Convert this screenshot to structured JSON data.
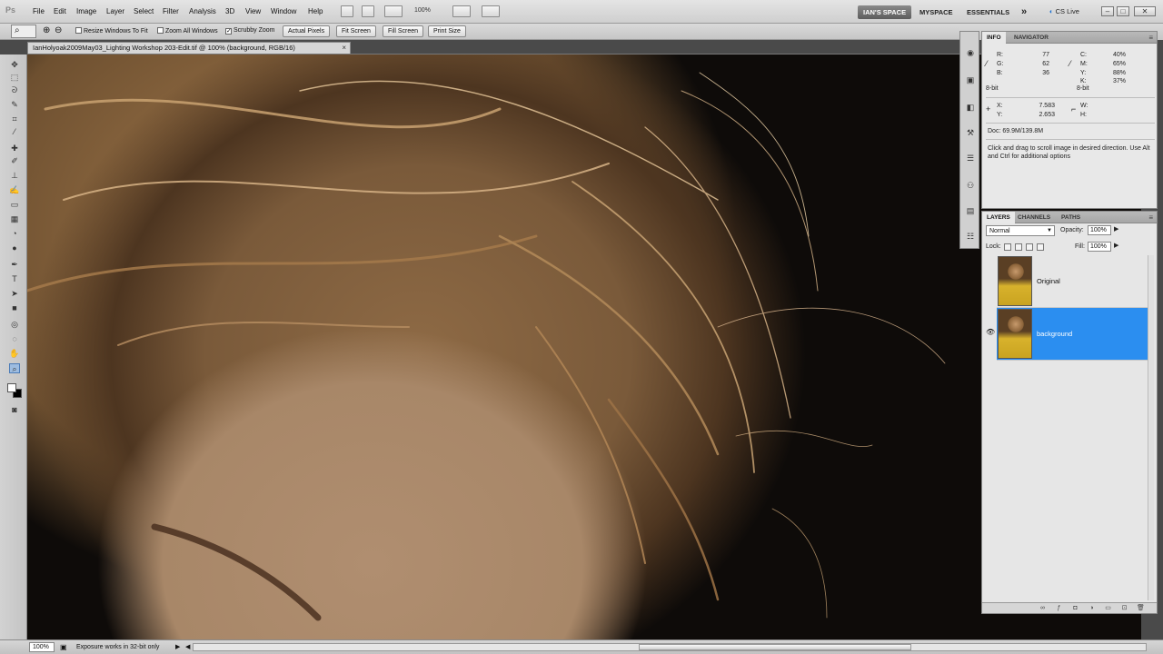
{
  "app": {
    "logo": "Ps"
  },
  "menu": [
    "File",
    "Edit",
    "Image",
    "Layer",
    "Select",
    "Filter",
    "Analysis",
    "3D",
    "View",
    "Window",
    "Help"
  ],
  "menubar": {
    "zoom": "100%",
    "workspaces": [
      "IAN'S SPACE",
      "MYSPACE",
      "ESSENTIALS"
    ],
    "more": "»",
    "cs_live": "CS Live"
  },
  "options": {
    "resize_windows": "Resize Windows To Fit",
    "zoom_all_windows": "Zoom All Windows",
    "scrubby_zoom": "Scrubby Zoom",
    "scrubby_checked": "✓",
    "buttons": [
      "Actual Pixels",
      "Fit Screen",
      "Fill Screen",
      "Print Size"
    ]
  },
  "document": {
    "tab_title": "IanHolyoak2009May03_Lighting Workshop 203-Edit.tif @ 100% (background, RGB/16)",
    "close": "×"
  },
  "info": {
    "tabs": [
      "INFO",
      "NAVIGATOR"
    ],
    "r_label": "R:",
    "r": "77",
    "g_label": "G:",
    "g": "62",
    "b_label": "B:",
    "b": "36",
    "c_label": "C:",
    "c": "40%",
    "m_label": "M:",
    "m": "65%",
    "y_label": "Y:",
    "y": "88%",
    "k_label": "K:",
    "k": "37%",
    "bit_left": "8-bit",
    "bit_right": "8-bit",
    "x_label": "X:",
    "x": "7.583",
    "yc_label": "Y:",
    "yc": "2.653",
    "w_label": "W:",
    "h_label": "H:",
    "doc": "Doc: 69.9M/139.8M",
    "hint": "Click and drag to scroll image in desired direction.  Use Alt and Ctrl for additional options"
  },
  "layers": {
    "tabs": [
      "LAYERS",
      "CHANNELS",
      "PATHS"
    ],
    "blend_mode": "Normal",
    "opacity_label": "Opacity:",
    "opacity": "100%",
    "lock_label": "Lock:",
    "fill_label": "Fill:",
    "fill": "100%",
    "items": [
      {
        "name": "Original",
        "visible": false,
        "selected": false
      },
      {
        "name": "background",
        "visible": true,
        "selected": true
      }
    ]
  },
  "status": {
    "zoom": "100%",
    "text": "Exposure works in 32-bit only"
  },
  "colors": {
    "selection": "#2b8ef0",
    "active_workspace": "#6a6a6a"
  }
}
